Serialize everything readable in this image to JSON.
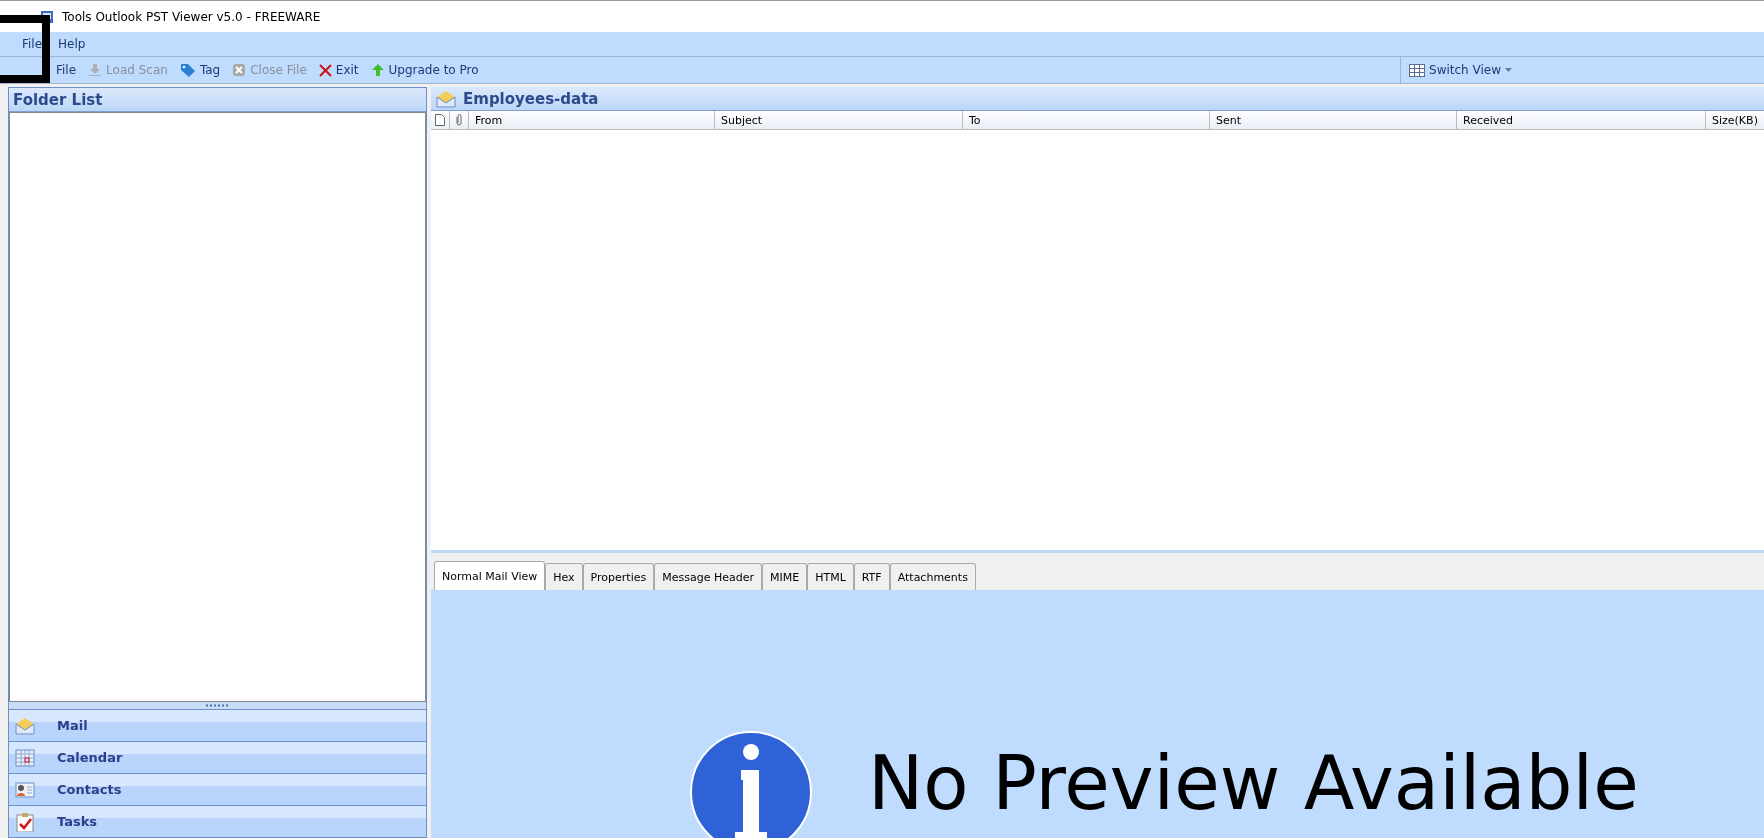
{
  "window": {
    "title": "Tools Outlook PST Viewer v5.0 - FREEWARE"
  },
  "menu": [
    "File",
    "Help"
  ],
  "toolbar": [
    {
      "kind": "add",
      "label": "File",
      "disabled": false
    },
    {
      "kind": "load",
      "label": "Load Scan",
      "disabled": true
    },
    {
      "kind": "tag",
      "label": "Tag",
      "disabled": false
    },
    {
      "kind": "close",
      "label": "Close File",
      "disabled": true
    },
    {
      "kind": "exit",
      "label": "Exit",
      "disabled": false
    },
    {
      "kind": "upgrade",
      "label": "Upgrade to Pro",
      "disabled": false
    }
  ],
  "switch_view": "Switch View",
  "folder_list": {
    "title": "Folder List"
  },
  "navigation": [
    {
      "kind": "mail",
      "label": "Mail"
    },
    {
      "kind": "calendar",
      "label": "Calendar"
    },
    {
      "kind": "contacts",
      "label": "Contacts"
    },
    {
      "kind": "tasks",
      "label": "Tasks"
    }
  ],
  "message_list": {
    "title": "Employees-data",
    "columns": [
      "From",
      "Subject",
      "To",
      "Sent",
      "Received",
      "Size(KB)"
    ]
  },
  "preview_tabs": [
    {
      "label": "Normal Mail View",
      "selected": true
    },
    {
      "label": "Hex",
      "selected": false
    },
    {
      "label": "Properties",
      "selected": false
    },
    {
      "label": "Message Header",
      "selected": false
    },
    {
      "label": "MIME",
      "selected": false
    },
    {
      "label": "HTML",
      "selected": false
    },
    {
      "label": "RTF",
      "selected": false
    },
    {
      "label": "Attachments",
      "selected": false
    }
  ],
  "preview": {
    "message": "No Preview Available"
  }
}
